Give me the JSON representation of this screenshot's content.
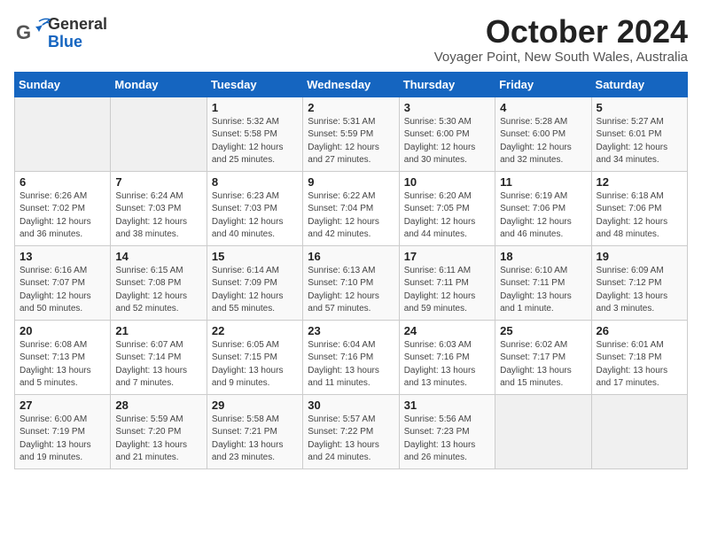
{
  "header": {
    "logo_general": "General",
    "logo_blue": "Blue",
    "month_year": "October 2024",
    "location": "Voyager Point, New South Wales, Australia"
  },
  "days_of_week": [
    "Sunday",
    "Monday",
    "Tuesday",
    "Wednesday",
    "Thursday",
    "Friday",
    "Saturday"
  ],
  "weeks": [
    [
      {
        "day": "",
        "info": ""
      },
      {
        "day": "",
        "info": ""
      },
      {
        "day": "1",
        "info": "Sunrise: 5:32 AM\nSunset: 5:58 PM\nDaylight: 12 hours\nand 25 minutes."
      },
      {
        "day": "2",
        "info": "Sunrise: 5:31 AM\nSunset: 5:59 PM\nDaylight: 12 hours\nand 27 minutes."
      },
      {
        "day": "3",
        "info": "Sunrise: 5:30 AM\nSunset: 6:00 PM\nDaylight: 12 hours\nand 30 minutes."
      },
      {
        "day": "4",
        "info": "Sunrise: 5:28 AM\nSunset: 6:00 PM\nDaylight: 12 hours\nand 32 minutes."
      },
      {
        "day": "5",
        "info": "Sunrise: 5:27 AM\nSunset: 6:01 PM\nDaylight: 12 hours\nand 34 minutes."
      }
    ],
    [
      {
        "day": "6",
        "info": "Sunrise: 6:26 AM\nSunset: 7:02 PM\nDaylight: 12 hours\nand 36 minutes."
      },
      {
        "day": "7",
        "info": "Sunrise: 6:24 AM\nSunset: 7:03 PM\nDaylight: 12 hours\nand 38 minutes."
      },
      {
        "day": "8",
        "info": "Sunrise: 6:23 AM\nSunset: 7:03 PM\nDaylight: 12 hours\nand 40 minutes."
      },
      {
        "day": "9",
        "info": "Sunrise: 6:22 AM\nSunset: 7:04 PM\nDaylight: 12 hours\nand 42 minutes."
      },
      {
        "day": "10",
        "info": "Sunrise: 6:20 AM\nSunset: 7:05 PM\nDaylight: 12 hours\nand 44 minutes."
      },
      {
        "day": "11",
        "info": "Sunrise: 6:19 AM\nSunset: 7:06 PM\nDaylight: 12 hours\nand 46 minutes."
      },
      {
        "day": "12",
        "info": "Sunrise: 6:18 AM\nSunset: 7:06 PM\nDaylight: 12 hours\nand 48 minutes."
      }
    ],
    [
      {
        "day": "13",
        "info": "Sunrise: 6:16 AM\nSunset: 7:07 PM\nDaylight: 12 hours\nand 50 minutes."
      },
      {
        "day": "14",
        "info": "Sunrise: 6:15 AM\nSunset: 7:08 PM\nDaylight: 12 hours\nand 52 minutes."
      },
      {
        "day": "15",
        "info": "Sunrise: 6:14 AM\nSunset: 7:09 PM\nDaylight: 12 hours\nand 55 minutes."
      },
      {
        "day": "16",
        "info": "Sunrise: 6:13 AM\nSunset: 7:10 PM\nDaylight: 12 hours\nand 57 minutes."
      },
      {
        "day": "17",
        "info": "Sunrise: 6:11 AM\nSunset: 7:11 PM\nDaylight: 12 hours\nand 59 minutes."
      },
      {
        "day": "18",
        "info": "Sunrise: 6:10 AM\nSunset: 7:11 PM\nDaylight: 13 hours\nand 1 minute."
      },
      {
        "day": "19",
        "info": "Sunrise: 6:09 AM\nSunset: 7:12 PM\nDaylight: 13 hours\nand 3 minutes."
      }
    ],
    [
      {
        "day": "20",
        "info": "Sunrise: 6:08 AM\nSunset: 7:13 PM\nDaylight: 13 hours\nand 5 minutes."
      },
      {
        "day": "21",
        "info": "Sunrise: 6:07 AM\nSunset: 7:14 PM\nDaylight: 13 hours\nand 7 minutes."
      },
      {
        "day": "22",
        "info": "Sunrise: 6:05 AM\nSunset: 7:15 PM\nDaylight: 13 hours\nand 9 minutes."
      },
      {
        "day": "23",
        "info": "Sunrise: 6:04 AM\nSunset: 7:16 PM\nDaylight: 13 hours\nand 11 minutes."
      },
      {
        "day": "24",
        "info": "Sunrise: 6:03 AM\nSunset: 7:16 PM\nDaylight: 13 hours\nand 13 minutes."
      },
      {
        "day": "25",
        "info": "Sunrise: 6:02 AM\nSunset: 7:17 PM\nDaylight: 13 hours\nand 15 minutes."
      },
      {
        "day": "26",
        "info": "Sunrise: 6:01 AM\nSunset: 7:18 PM\nDaylight: 13 hours\nand 17 minutes."
      }
    ],
    [
      {
        "day": "27",
        "info": "Sunrise: 6:00 AM\nSunset: 7:19 PM\nDaylight: 13 hours\nand 19 minutes."
      },
      {
        "day": "28",
        "info": "Sunrise: 5:59 AM\nSunset: 7:20 PM\nDaylight: 13 hours\nand 21 minutes."
      },
      {
        "day": "29",
        "info": "Sunrise: 5:58 AM\nSunset: 7:21 PM\nDaylight: 13 hours\nand 23 minutes."
      },
      {
        "day": "30",
        "info": "Sunrise: 5:57 AM\nSunset: 7:22 PM\nDaylight: 13 hours\nand 24 minutes."
      },
      {
        "day": "31",
        "info": "Sunrise: 5:56 AM\nSunset: 7:23 PM\nDaylight: 13 hours\nand 26 minutes."
      },
      {
        "day": "",
        "info": ""
      },
      {
        "day": "",
        "info": ""
      }
    ]
  ]
}
